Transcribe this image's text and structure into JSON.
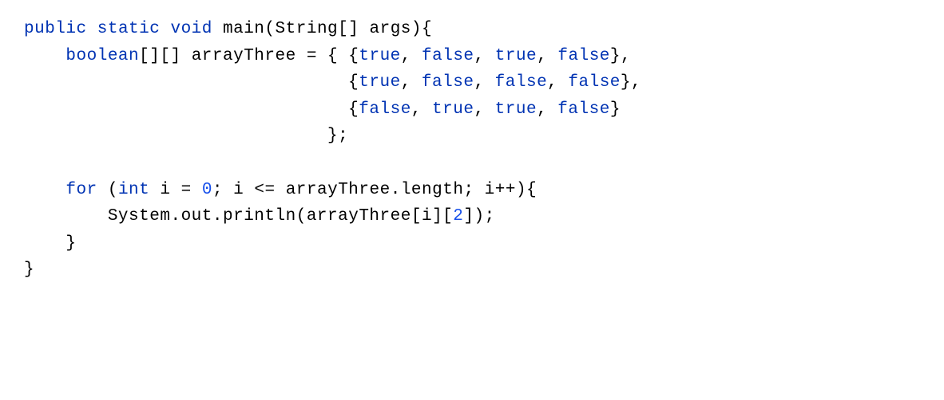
{
  "code": {
    "language": "java",
    "tokens": {
      "kw_public": "public",
      "kw_static": "static",
      "kw_void": "void",
      "kw_boolean": "boolean",
      "kw_for": "for",
      "kw_int": "int",
      "kw_true": "true",
      "kw_false": "false",
      "id_main": "main",
      "id_String": "String",
      "id_args": "args",
      "id_arrayThree": "arrayThree",
      "id_i": "i",
      "id_length": "length",
      "id_System": "System",
      "id_out": "out",
      "id_println": "println",
      "lit_0": "0",
      "lit_2": "2",
      "sym_brackets2": "[]",
      "sym_lparen": "(",
      "sym_rparen": ")",
      "sym_lbrace": "{",
      "sym_rbrace": "}",
      "sym_lbracket": "[",
      "sym_rbracket": "]",
      "sym_eq": "=",
      "sym_le": "<=",
      "sym_inc": "++",
      "sym_comma": ",",
      "sym_dot": ".",
      "sym_semi": ";"
    },
    "array_data": [
      [
        true,
        false,
        true,
        false
      ],
      [
        true,
        false,
        false,
        false
      ],
      [
        false,
        true,
        true,
        false
      ]
    ]
  }
}
